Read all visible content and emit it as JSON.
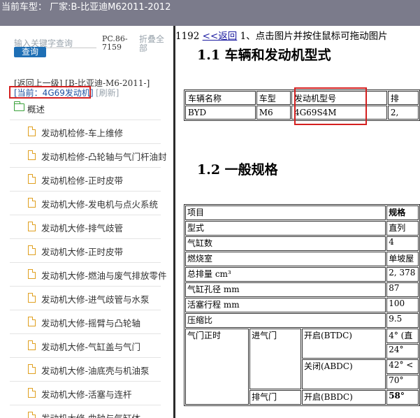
{
  "title_bar": {
    "text": "当前车型：  厂家:B-比亚迪M62011-2012"
  },
  "sidebar": {
    "search_placeholder": "输入关键字查询",
    "search_button": "查询",
    "pc_label": "PC.86-7159",
    "collapse_label": "折叠全部",
    "back_link": "[返回上一级] [B-比亚迪-M6-2011-]",
    "current_label": "[当前：4G69发动机]",
    "refresh_label": "[刷新]",
    "overview_label": "概述",
    "items": [
      {
        "label": "发动机检修-车上维修"
      },
      {
        "label": "发动机检修-凸轮轴与气门杆油封"
      },
      {
        "label": "发动机检修-正时皮带"
      },
      {
        "label": "发动机大修-发电机与点火系统"
      },
      {
        "label": "发动机大修-排气歧管"
      },
      {
        "label": "发动机大修-正时皮带"
      },
      {
        "label": "发动机大修-燃油与废气排放零件"
      },
      {
        "label": "发动机大修-进气歧管与水泵"
      },
      {
        "label": "发动机大修-摇臂与凸轮轴"
      },
      {
        "label": "发动机大修-气缸盖与气门"
      },
      {
        "label": "发动机大修-油底壳与机油泵"
      },
      {
        "label": "发动机大修-活塞与连杆"
      },
      {
        "label": "发动机大修-曲轴与气缸体"
      }
    ]
  },
  "content": {
    "page_number": "1192",
    "back_link": "<<返回",
    "instruction": "1、点击图片并按住鼠标可拖动图片",
    "heading1": "1.1  车辆和发动机型式",
    "table1": {
      "headers": [
        "车辆名称",
        "车型",
        "发动机型号",
        "排"
      ],
      "row": [
        "BYD",
        "M6",
        "4G69S4M",
        "2,"
      ]
    },
    "heading2": "1.2  一般规格",
    "table2": {
      "header": [
        "项目",
        "规格"
      ],
      "rows": [
        [
          "型式",
          "直列"
        ],
        [
          "气缸数",
          "4"
        ],
        [
          "燃烧室",
          "单坡屋"
        ],
        [
          "总排量 cm³",
          "2, 378"
        ],
        [
          "气缸孔径 mm",
          "87"
        ],
        [
          "活塞行程 mm",
          "100"
        ],
        [
          "压缩比",
          "9.5"
        ]
      ],
      "valve_timing": {
        "label": "气门正时",
        "intake": "进气门",
        "exhaust": "排气门",
        "open_btdc": "开启(BTDC)",
        "close_abdc": "关闭(ABDC)",
        "exhaust_open": "开启(BBDC)",
        "values": [
          "4° (直",
          "24°",
          "42° <",
          "70°",
          "58°"
        ]
      }
    }
  }
}
